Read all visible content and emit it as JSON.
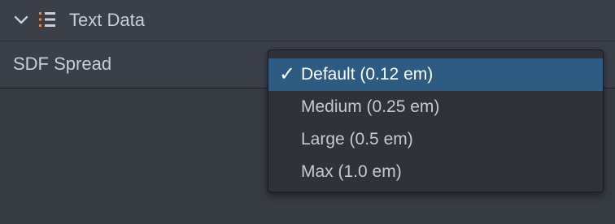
{
  "section": {
    "title": "Text Data",
    "expand_icon": "chevron-down-icon",
    "section_icon": "list-icon",
    "icon_accent_color": "#e8843c"
  },
  "property": {
    "label": "SDF Spread"
  },
  "dropdown": {
    "selected_index": 0,
    "options": [
      {
        "label": "Default (0.12 em)",
        "selected": true
      },
      {
        "label": "Medium (0.25 em)",
        "selected": false
      },
      {
        "label": "Large (0.5 em)",
        "selected": false
      },
      {
        "label": "Max (1.0 em)",
        "selected": false
      }
    ],
    "check_glyph": "✓",
    "highlight_color": "#2d5b82"
  }
}
